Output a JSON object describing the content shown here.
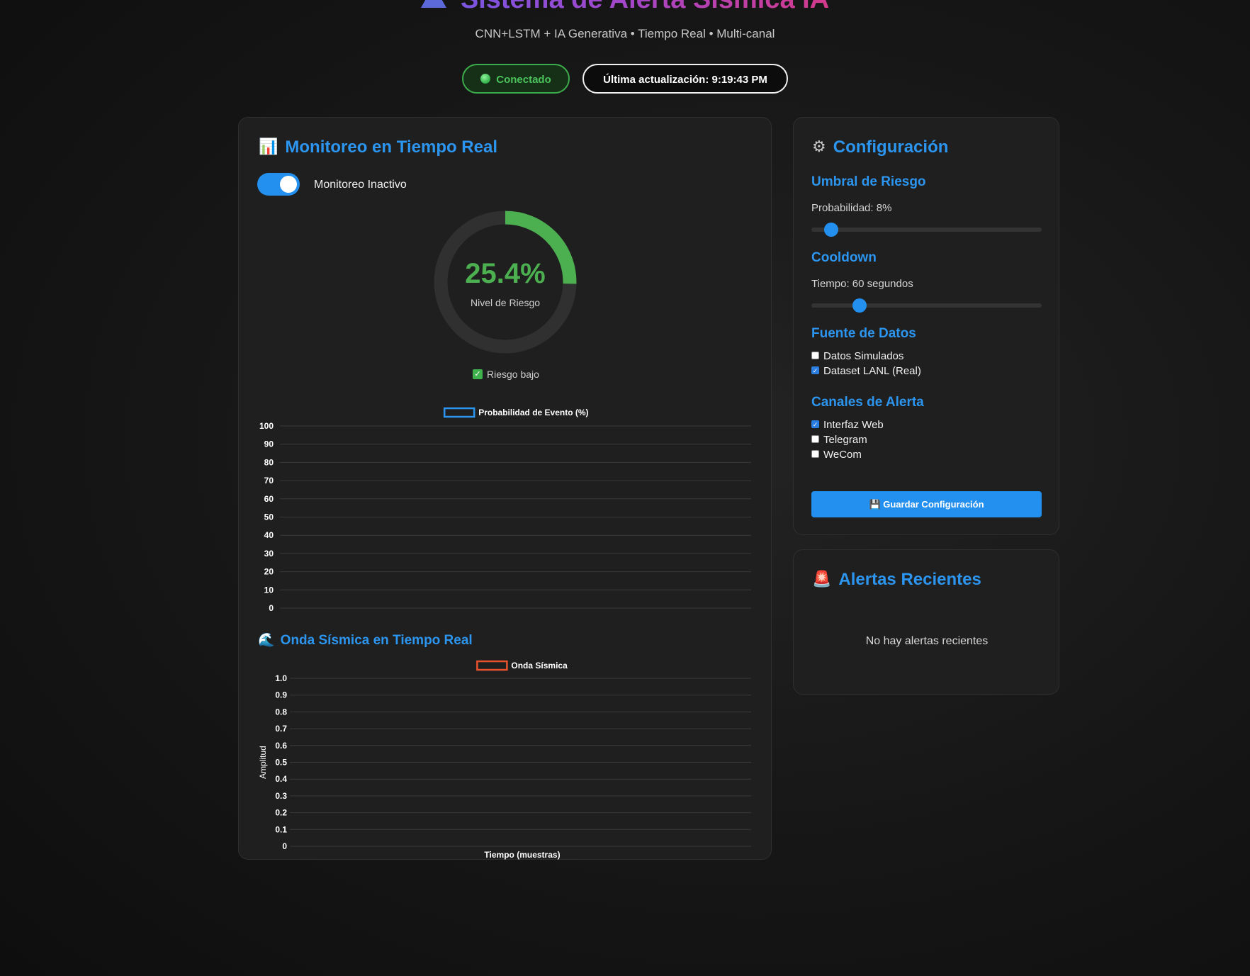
{
  "header": {
    "title": "Sistema de Alerta Sísmica IA",
    "subtitle": "CNN+LSTM + IA Generativa • Tiempo Real • Multi-canal",
    "status_label": "Conectado",
    "last_update": "Última actualización: 9:19:43 PM"
  },
  "monitor": {
    "title": "Monitoreo en Tiempo Real",
    "title_icon": "bar-chart-icon",
    "toggle_label": "Monitoreo Inactivo",
    "toggle_on": true,
    "risk_value": "25.4%",
    "risk_fraction": 0.254,
    "risk_label": "Nivel de Riesgo",
    "risk_tag": "Riesgo bajo",
    "colors": {
      "accent": "#2c95ef",
      "risk_low": "#4caf50",
      "wave": "#e8532e"
    }
  },
  "chart_data": [
    {
      "type": "line",
      "legend": [
        "Probabilidad de Evento (%)"
      ],
      "series": [
        {
          "name": "Probabilidad de Evento (%)",
          "values": []
        }
      ],
      "y_ticks": [
        "100",
        "90",
        "80",
        "70",
        "60",
        "50",
        "40",
        "30",
        "20",
        "10",
        "0"
      ],
      "ylim": [
        0,
        100
      ],
      "grid": true,
      "legend_position": "top"
    },
    {
      "type": "line",
      "title": "Onda Sísmica en Tiempo Real",
      "legend": [
        "Onda Sísmica"
      ],
      "series": [
        {
          "name": "Onda Sísmica",
          "values": []
        }
      ],
      "y_ticks": [
        "1.0",
        "0.9",
        "0.8",
        "0.7",
        "0.6",
        "0.5",
        "0.4",
        "0.3",
        "0.2",
        "0.1",
        "0"
      ],
      "ylim": [
        0,
        1
      ],
      "xlabel": "Tiempo (muestras)",
      "ylabel": "Amplitud",
      "grid": true,
      "legend_position": "top"
    }
  ],
  "wave_section": {
    "title": "Onda Sísmica en Tiempo Real",
    "icon": "wave-icon"
  },
  "config": {
    "title": "Configuración",
    "title_icon": "gear-icon",
    "threshold_heading": "Umbral de Riesgo",
    "threshold_text": "Probabilidad: 8%",
    "threshold_value": 0.08,
    "cooldown_heading": "Cooldown",
    "cooldown_text": "Tiempo: 60 segundos",
    "cooldown_fraction": 0.19,
    "source_heading": "Fuente de Datos",
    "sources": [
      {
        "label": "Datos Simulados",
        "checked": false
      },
      {
        "label": "Dataset LANL (Real)",
        "checked": true
      }
    ],
    "channels_heading": "Canales de Alerta",
    "channels": [
      {
        "label": "Interfaz Web",
        "checked": true
      },
      {
        "label": "Telegram",
        "checked": false
      },
      {
        "label": "WeCom",
        "checked": false
      }
    ],
    "save_label": "Guardar Configuración",
    "save_icon": "floppy-disk-icon"
  },
  "alerts": {
    "title": "Alertas Recientes",
    "title_icon": "siren-icon",
    "empty_text": "No hay alertas recientes"
  }
}
